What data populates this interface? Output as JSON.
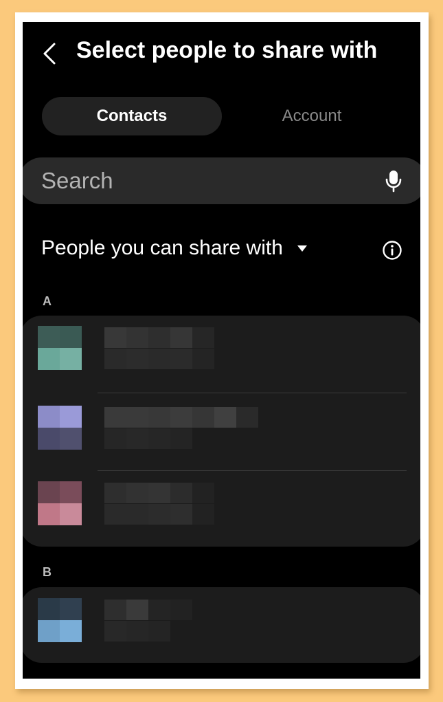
{
  "header": {
    "title": "Select people to share with"
  },
  "tabs": [
    {
      "label": "Contacts",
      "selected": true
    },
    {
      "label": "Account",
      "selected": false
    }
  ],
  "search": {
    "placeholder": "Search",
    "value": ""
  },
  "section": {
    "title": "People you can share with"
  },
  "groups": [
    {
      "letter": "A"
    },
    {
      "letter": "B"
    }
  ],
  "colors": {
    "background": "#000000",
    "card": "#1c1c1c",
    "tab_selected": "#222222",
    "search_bar": "#2a2a2a",
    "avatar_a1": "#6aa89a",
    "avatar_a2": "#9a9ad8",
    "avatar_a3": "#c98a9a",
    "avatar_b1": "#7aaed8"
  },
  "icons": {
    "back": "chevron-left-icon",
    "mic": "microphone-icon",
    "dropdown": "caret-down-icon",
    "info": "info-circle-icon"
  }
}
